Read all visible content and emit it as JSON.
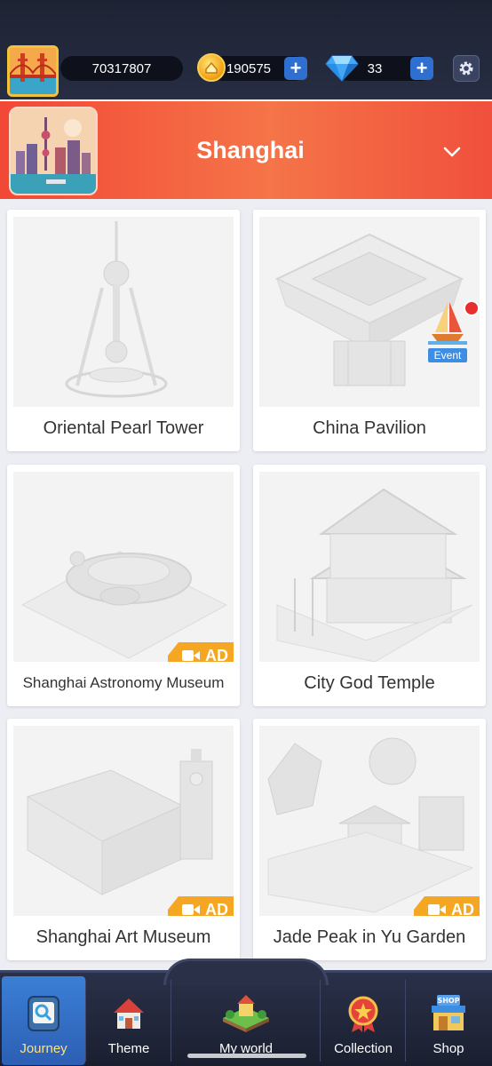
{
  "header": {
    "player_score": "70317807",
    "coins": "190575",
    "gems": "33",
    "plus_symbol": "+",
    "settings_icon": "gear-icon"
  },
  "city": {
    "name": "Shanghai",
    "dropdown_icon": "chevron-down-icon",
    "accent_color": "#f24836"
  },
  "cards": [
    {
      "title": "Oriental Pearl Tower",
      "badge": ""
    },
    {
      "title": "China Pavilion",
      "badge": "Event"
    },
    {
      "title": "Shanghai Astronomy Museum",
      "badge": "AD"
    },
    {
      "title": "City God Temple",
      "badge": ""
    },
    {
      "title": "Shanghai Art Museum",
      "badge": "AD"
    },
    {
      "title": "Jade Peak in Yu Garden",
      "badge": "AD"
    }
  ],
  "nav": {
    "items": [
      {
        "label": "Journey",
        "active": true
      },
      {
        "label": "Theme",
        "active": false
      },
      {
        "label": "My world",
        "active": false
      },
      {
        "label": "Collection",
        "active": false
      },
      {
        "label": "Shop",
        "active": false
      }
    ],
    "shop_sign": "SHOP"
  }
}
